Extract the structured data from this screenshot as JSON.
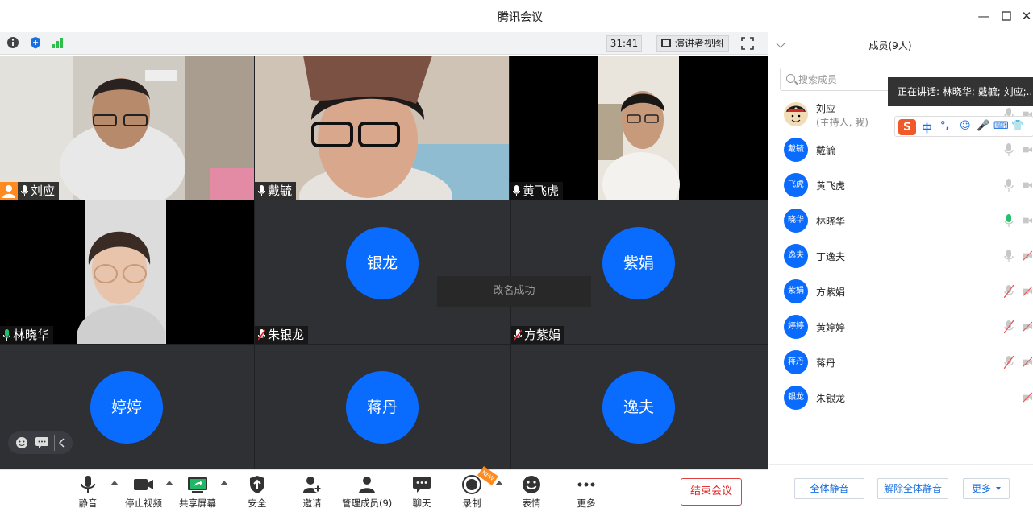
{
  "window": {
    "title": "腾讯会议"
  },
  "statusbar": {
    "timer": "31:41",
    "view_label": "演讲者视图"
  },
  "tiles": [
    {
      "name": "刘应",
      "host": true,
      "video": true,
      "mic": "on"
    },
    {
      "name": "戴毓",
      "video": true,
      "mic": "on"
    },
    {
      "name": "黄飞虎",
      "video": true,
      "mic": "on"
    },
    {
      "name": "林晓华",
      "video": true,
      "mic": "active",
      "speaking": true
    },
    {
      "name": "朱银龙",
      "avatar": "银龙",
      "mic": "muted"
    },
    {
      "name": "方紫娟",
      "avatar": "紫娟",
      "mic": "muted"
    },
    {
      "avatar": "婷婷"
    },
    {
      "avatar": "蒋丹"
    },
    {
      "avatar": "逸夫"
    }
  ],
  "toast": "改名成功",
  "toolbar": {
    "mute": "静音",
    "stop_video": "停止视频",
    "share": "共享屏幕",
    "security": "安全",
    "invite": "邀请",
    "manage": "管理成员(9)",
    "chat": "聊天",
    "record": "录制",
    "record_badge": "NEW",
    "emoji": "表情",
    "more": "更多",
    "end": "结束会议"
  },
  "panel": {
    "title": "成员(9人)",
    "search_placeholder": "搜索成员",
    "tooltip": "正在讲话: 林晓华; 戴毓; 刘应;...",
    "ime_keys": [
      "中",
      "°,",
      "☺",
      "🎤",
      "⌨",
      "👕",
      "⚙"
    ],
    "members": [
      {
        "avatar": "",
        "name": "刘应",
        "sub": "(主持人, 我)",
        "mic": "on",
        "cam": "on"
      },
      {
        "avatar": "戴毓",
        "name": "戴毓",
        "mic": "on",
        "cam": "on"
      },
      {
        "avatar": "飞虎",
        "name": "黄飞虎",
        "mic": "on",
        "cam": "on"
      },
      {
        "avatar": "晓华",
        "name": "林晓华",
        "mic": "active",
        "cam": "on"
      },
      {
        "avatar": "逸夫",
        "name": "丁逸夫",
        "mic": "on",
        "cam": "off"
      },
      {
        "avatar": "紫娟",
        "name": "方紫娟",
        "mic": "off",
        "cam": "off"
      },
      {
        "avatar": "婷婷",
        "name": "黄婷婷",
        "mic": "off",
        "cam": "off"
      },
      {
        "avatar": "蒋丹",
        "name": "蒋丹",
        "mic": "off",
        "cam": "off"
      },
      {
        "avatar": "银龙",
        "name": "朱银龙",
        "mic": "none",
        "cam": "off"
      }
    ],
    "mute_all": "全体静音",
    "unmute_all": "解除全体静音",
    "more": "更多"
  },
  "colors": {
    "accent": "#0a6cff",
    "danger": "#e02020",
    "speaking": "#21c26b",
    "host_badge": "#ff8a1f"
  }
}
